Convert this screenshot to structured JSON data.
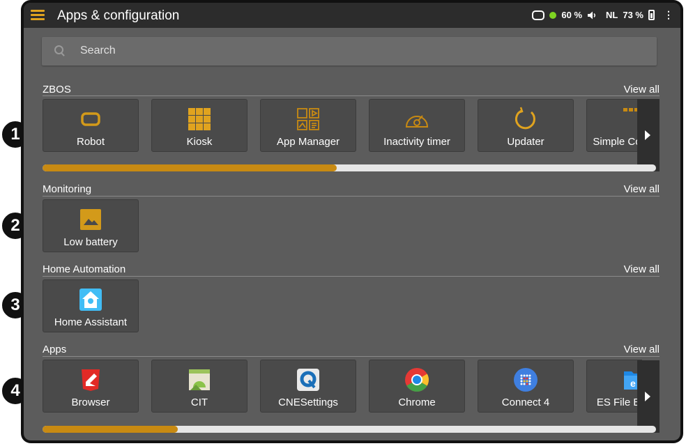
{
  "header": {
    "title": "Apps & configuration",
    "battery_robot": "60 %",
    "language": "NL",
    "battery_tablet": "73 %"
  },
  "search": {
    "placeholder": "Search"
  },
  "badges": [
    "1",
    "2",
    "3",
    "4"
  ],
  "sections": {
    "zbos": {
      "title": "ZBOS",
      "view_all": "View all",
      "progress": 0.48,
      "tiles": [
        {
          "label": "Robot",
          "icon": "robot-icon"
        },
        {
          "label": "Kiosk",
          "icon": "grid-icon"
        },
        {
          "label": "App Manager",
          "icon": "app-manager-icon"
        },
        {
          "label": "Inactivity timer",
          "icon": "speedometer-icon"
        },
        {
          "label": "Updater",
          "icon": "refresh-icon"
        },
        {
          "label": "Simple Composer",
          "icon": "composer-icon"
        }
      ]
    },
    "monitoring": {
      "title": "Monitoring",
      "view_all": "View all",
      "tiles": [
        {
          "label": "Low battery",
          "icon": "image-icon"
        }
      ]
    },
    "home_automation": {
      "title": "Home Automation",
      "view_all": "View all",
      "tiles": [
        {
          "label": "Home Assistant",
          "icon": "home-assistant-icon"
        }
      ]
    },
    "apps": {
      "title": "Apps",
      "view_all": "View all",
      "progress": 0.22,
      "tiles": [
        {
          "label": "Browser",
          "icon": "browser-icon"
        },
        {
          "label": "CIT",
          "icon": "android-icon"
        },
        {
          "label": "CNESettings",
          "icon": "q-settings-icon"
        },
        {
          "label": "Chrome",
          "icon": "chrome-icon"
        },
        {
          "label": "Connect 4",
          "icon": "connect4-icon"
        },
        {
          "label": "ES File Explorer",
          "icon": "es-file-explorer-icon"
        }
      ]
    }
  },
  "colors": {
    "accent": "#c88a12",
    "background": "#5c5c5c",
    "topbar": "#2c2c2c",
    "tile": "#4a4a4a"
  }
}
